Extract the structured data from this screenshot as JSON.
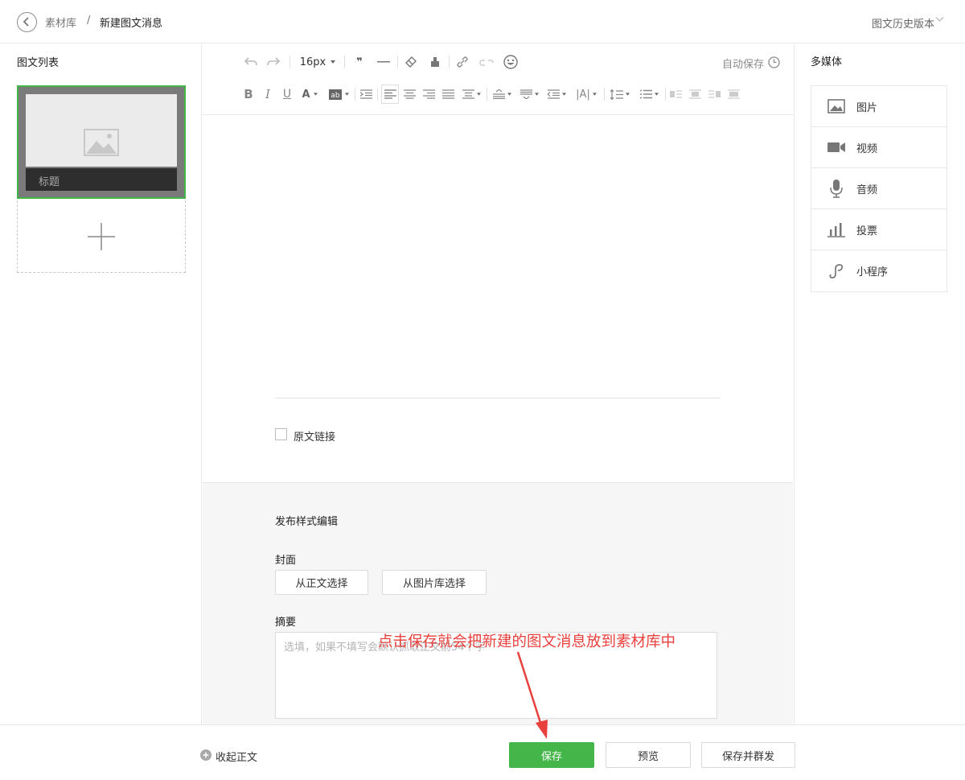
{
  "header": {
    "breadcrumb_parent": "素材库",
    "breadcrumb_separator": "/",
    "breadcrumb_current": "新建图文消息",
    "history_label": "图文历史版本"
  },
  "left_panel": {
    "title": "图文列表",
    "card_title": "标题"
  },
  "toolbar": {
    "font_size": "16px",
    "autosave_label": "自动保存"
  },
  "editor": {
    "original_link_label": "原文链接"
  },
  "publish": {
    "section_title": "发布样式编辑",
    "cover_label": "封面",
    "cover_from_body": "从正文选择",
    "cover_from_library": "从图片库选择",
    "summary_label": "摘要",
    "summary_placeholder": "选填，如果不填写会默认抓取正文前54个字"
  },
  "annotation": {
    "text": "点击保存就会把新建的图文消息放到素材库中",
    "color": "#e8413d"
  },
  "right_panel": {
    "title": "多媒体",
    "items": [
      {
        "label": "图片",
        "icon": "image-icon"
      },
      {
        "label": "视频",
        "icon": "video-icon"
      },
      {
        "label": "音频",
        "icon": "microphone-icon"
      },
      {
        "label": "投票",
        "icon": "vote-chart-icon"
      },
      {
        "label": "小程序",
        "icon": "mini-program-icon"
      }
    ]
  },
  "footer": {
    "collapse_label": "收起正文",
    "save_label": "保存",
    "preview_label": "预览",
    "save_and_send_label": "保存并群发"
  },
  "colors": {
    "accent_green": "#44b549",
    "border": "#e7e7eb"
  }
}
